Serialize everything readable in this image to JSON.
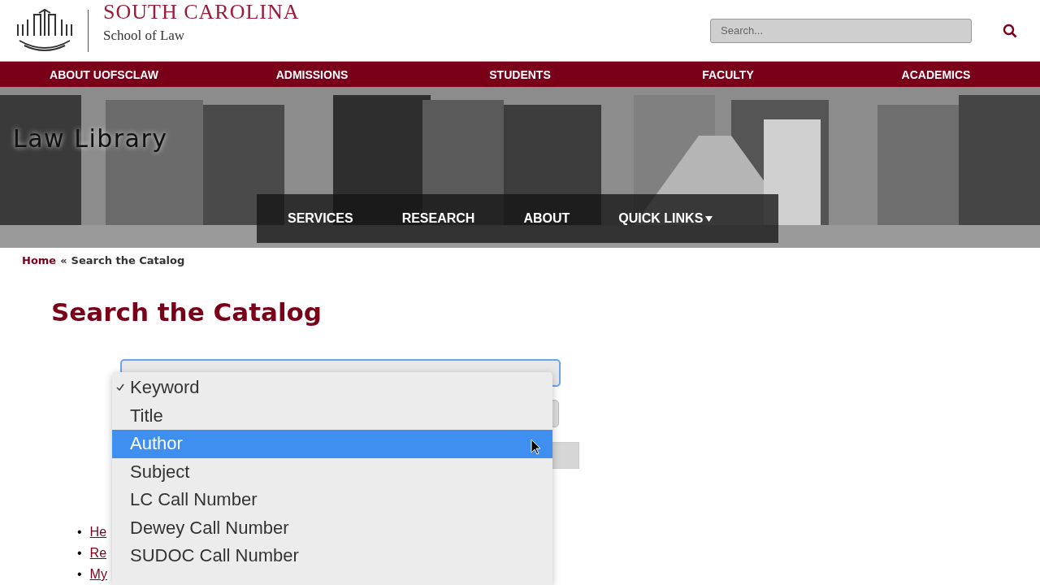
{
  "header": {
    "logo_wordmark": "SOUTH CAROLINA",
    "logo_subtitle": "School of Law",
    "search": {
      "placeholder": "Search..."
    }
  },
  "main_nav": [
    {
      "label": "ABOUT UOFSCLAW"
    },
    {
      "label": "ADMISSIONS"
    },
    {
      "label": "STUDENTS"
    },
    {
      "label": "FACULTY"
    },
    {
      "label": "ACADEMICS"
    }
  ],
  "banner": {
    "title": "Law Library",
    "kind": "picture"
  },
  "sub_nav": [
    {
      "label": "SERVICES",
      "has_menu": false
    },
    {
      "label": "RESEARCH",
      "has_menu": false
    },
    {
      "label": "ABOUT",
      "has_menu": false
    },
    {
      "label": "QUICK LINKS",
      "has_menu": true
    }
  ],
  "breadcrumb": {
    "home": "Home",
    "separator": "«",
    "current": "Search the Catalog"
  },
  "page_title": "Search the Catalog",
  "links": [
    {
      "bullet": "•",
      "label": "He"
    },
    {
      "bullet": "•",
      "label": "Re"
    },
    {
      "bullet": "•",
      "label": "My"
    }
  ],
  "dropdown_menu": [
    {
      "label": "Keyword",
      "checked": true,
      "selected": false
    },
    {
      "label": "Title",
      "checked": false,
      "selected": false
    },
    {
      "label": "Author",
      "checked": false,
      "selected": true
    },
    {
      "label": "Subject",
      "checked": false,
      "selected": false
    },
    {
      "label": "LC Call Number",
      "checked": false,
      "selected": false
    },
    {
      "label": "Dewey Call Number",
      "checked": false,
      "selected": false
    },
    {
      "label": "SUDOC Call Number",
      "checked": false,
      "selected": false
    }
  ]
}
